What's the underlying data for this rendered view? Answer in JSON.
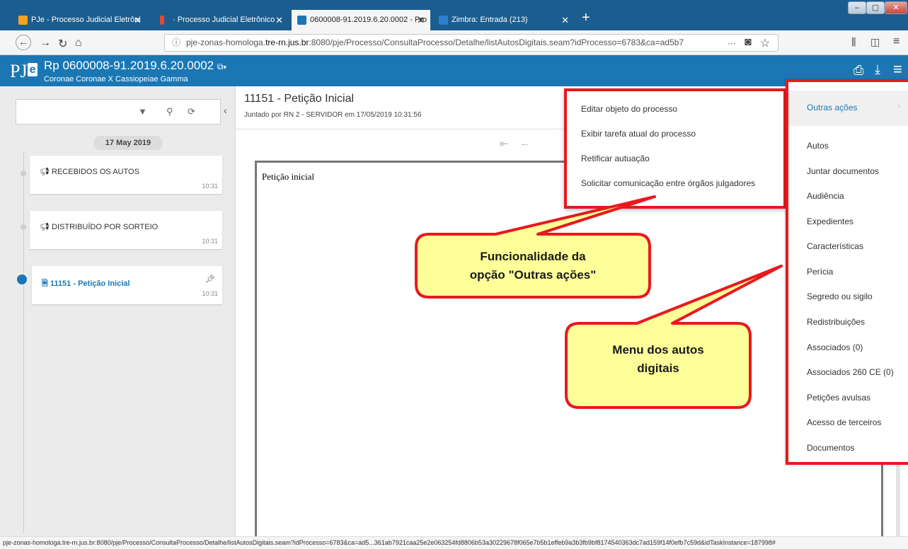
{
  "browser": {
    "tabs": [
      {
        "label": "PJe - Processo Judicial Eletrôni",
        "favicon_color": "#f2a31b"
      },
      {
        "label": "· Processo Judicial Eletrônico",
        "favicon_color": "#e04a2f"
      },
      {
        "label": "0600008-91.2019.6.20.0002 - Pro",
        "favicon_color": "#1a77b4"
      },
      {
        "label": "Zimbra: Entrada (213)",
        "favicon_color": "#2a7fcf"
      }
    ],
    "url_prefix": "pje-zonas-homologa.",
    "url_host": "tre-rn.jus.br",
    "url_rest": ":8080/pje/Processo/ConsultaProcesso/Detalhe/listAutosDigitais.seam?idProcesso=6783&ca=ad5b7",
    "url_more": "···",
    "status_url": "pje-zonas-homologa.tre-rn.jus.br:8080/pje/Processo/ConsultaProcesso/Detalhe/listAutosDigitais.seam?idProcesso=6783&ca=ad5...361ab7921caa25e2e063254fd8806b53a30229678f065e7b5b1effeb9a3b3fb9bf8174540363dc7ad159f14f0efb7c59d&idTaskInstance=187998#"
  },
  "app": {
    "logo_main": "PJ",
    "logo_badge": "e",
    "process_title": "Rp 0600008-91.2019.6.20.0002",
    "parties": "Coronae Coronae X Cassiopeiae Gamma",
    "header_color": "#1a77b4"
  },
  "timeline": {
    "date": "17 May 2019",
    "items": [
      {
        "label": "RECEBIDOS OS AUTOS",
        "time": "10:31"
      },
      {
        "label": "DISTRIBUÍDO POR SORTEIO",
        "time": "10:31"
      },
      {
        "label": "11151 - Petição Inicial",
        "time": "10:31"
      }
    ]
  },
  "document": {
    "title": "11151 - Petição Inicial",
    "subtitle": "Juntado por RN 2 - SERVIDOR em 17/05/2019 10:31:56",
    "body_text": "Petição inicial"
  },
  "submenu": {
    "items": [
      "Editar objeto do processo",
      "Exibir tarefa atual do processo",
      "Retificar autuação",
      "Solicitar comunicação entre órgãos julgadores"
    ]
  },
  "autos_menu": {
    "active": "Outras ações",
    "items": [
      "Autos",
      "Juntar documentos",
      "Audiência",
      "Expedientes",
      "Características",
      "Perícia",
      "Segredo ou sigilo",
      "Redistribuições",
      "Associados (0)",
      "Associados 260 CE (0)",
      "Petições avulsas",
      "Acesso de terceiros",
      "Documentos"
    ]
  },
  "callouts": {
    "first_line1": "Funcionalidade da",
    "first_line2": "opção \"Outras ações\"",
    "second_line1": "Menu dos autos",
    "second_line2": "digitais",
    "fill": "#ffff99",
    "border": "#e8191e"
  }
}
